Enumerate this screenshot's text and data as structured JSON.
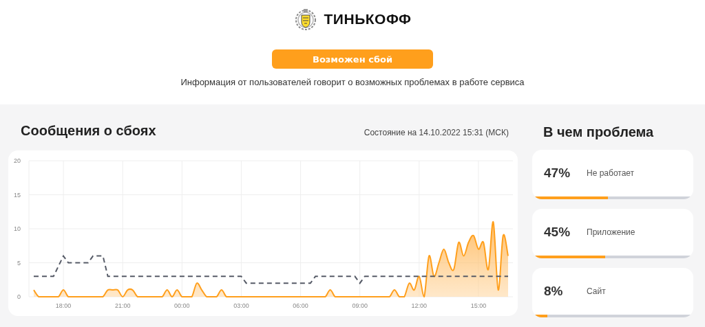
{
  "header": {
    "brand": "ТИНЬКОФФ",
    "status_button": "Возможен сбой",
    "description": "Информация от пользователей говорит о возможных проблемах в работе сервиса"
  },
  "reports": {
    "title": "Сообщения о сбоях",
    "timestamp": "Состояние на 14.10.2022 15:31 (МСК)",
    "chart_data": {
      "type": "area",
      "grid": true,
      "ylim": [
        0,
        20
      ],
      "yticks": [
        0,
        5,
        10,
        15,
        20
      ],
      "categories": [
        null,
        null,
        null,
        null,
        null,
        null,
        "18:00",
        null,
        null,
        null,
        null,
        null,
        null,
        null,
        null,
        null,
        null,
        null,
        "21:00",
        null,
        null,
        null,
        null,
        null,
        null,
        null,
        null,
        null,
        null,
        null,
        "00:00",
        null,
        null,
        null,
        null,
        null,
        null,
        null,
        null,
        null,
        null,
        null,
        "03:00",
        null,
        null,
        null,
        null,
        null,
        null,
        null,
        null,
        null,
        null,
        null,
        "06:00",
        null,
        null,
        null,
        null,
        null,
        null,
        null,
        null,
        null,
        null,
        null,
        "09:00",
        null,
        null,
        null,
        null,
        null,
        null,
        null,
        null,
        null,
        null,
        null,
        "12:00",
        null,
        null,
        null,
        null,
        null,
        null,
        null,
        null,
        null,
        null,
        null,
        "15:00",
        null,
        null,
        null,
        null,
        null,
        null
      ],
      "series": [
        {
          "color": "#ff9f1c",
          "values": [
            1,
            0,
            0,
            0,
            0,
            0,
            1,
            0,
            0,
            0,
            0,
            0,
            0,
            0,
            0,
            1,
            1,
            1,
            0,
            1,
            1,
            0,
            0,
            0,
            0,
            0,
            0,
            1,
            0,
            1,
            0,
            0,
            0,
            2,
            1,
            0,
            0,
            0,
            1,
            0,
            0,
            0,
            0,
            0,
            0,
            0,
            0,
            0,
            0,
            0,
            0,
            0,
            0,
            0,
            0,
            0,
            0,
            0,
            0,
            0,
            1,
            0,
            0,
            0,
            0,
            0,
            0,
            0,
            0,
            0,
            0,
            0,
            0,
            1,
            0,
            0,
            2,
            1,
            3,
            0,
            6,
            3,
            5,
            7,
            5,
            4,
            8,
            6,
            8,
            9,
            7,
            8,
            4,
            11,
            1,
            9,
            6
          ]
        },
        {
          "type": "line",
          "line_style": "dashed",
          "color": "#555a66",
          "values": [
            3,
            3,
            3,
            3,
            3,
            4.5,
            6,
            5,
            5,
            5,
            5,
            5,
            6,
            6,
            6,
            3,
            3,
            3,
            3,
            3,
            3,
            3,
            3,
            3,
            3,
            3,
            3,
            3,
            3,
            3,
            3,
            3,
            3,
            3,
            3,
            3,
            3,
            3,
            3,
            3,
            3,
            3,
            3,
            2,
            2,
            2,
            2,
            2,
            2,
            2,
            2,
            2,
            2,
            2,
            2,
            2,
            2,
            3,
            3,
            3,
            3,
            3,
            3,
            3,
            3,
            3,
            2,
            3,
            3,
            3,
            3,
            3,
            3,
            3,
            3,
            3,
            3,
            3,
            3,
            3,
            3,
            3,
            3,
            3,
            3,
            3,
            3,
            3,
            3,
            3,
            3,
            3,
            3,
            3,
            3,
            3,
            3
          ]
        }
      ]
    }
  },
  "problems": {
    "title": "В чем проблема",
    "items": [
      {
        "percent": "47%",
        "label": "Не работает",
        "level": 0.47
      },
      {
        "percent": "45%",
        "label": "Приложение",
        "level": 0.45
      },
      {
        "percent": "8%",
        "label": "Сайт",
        "level": 0.08
      }
    ]
  }
}
